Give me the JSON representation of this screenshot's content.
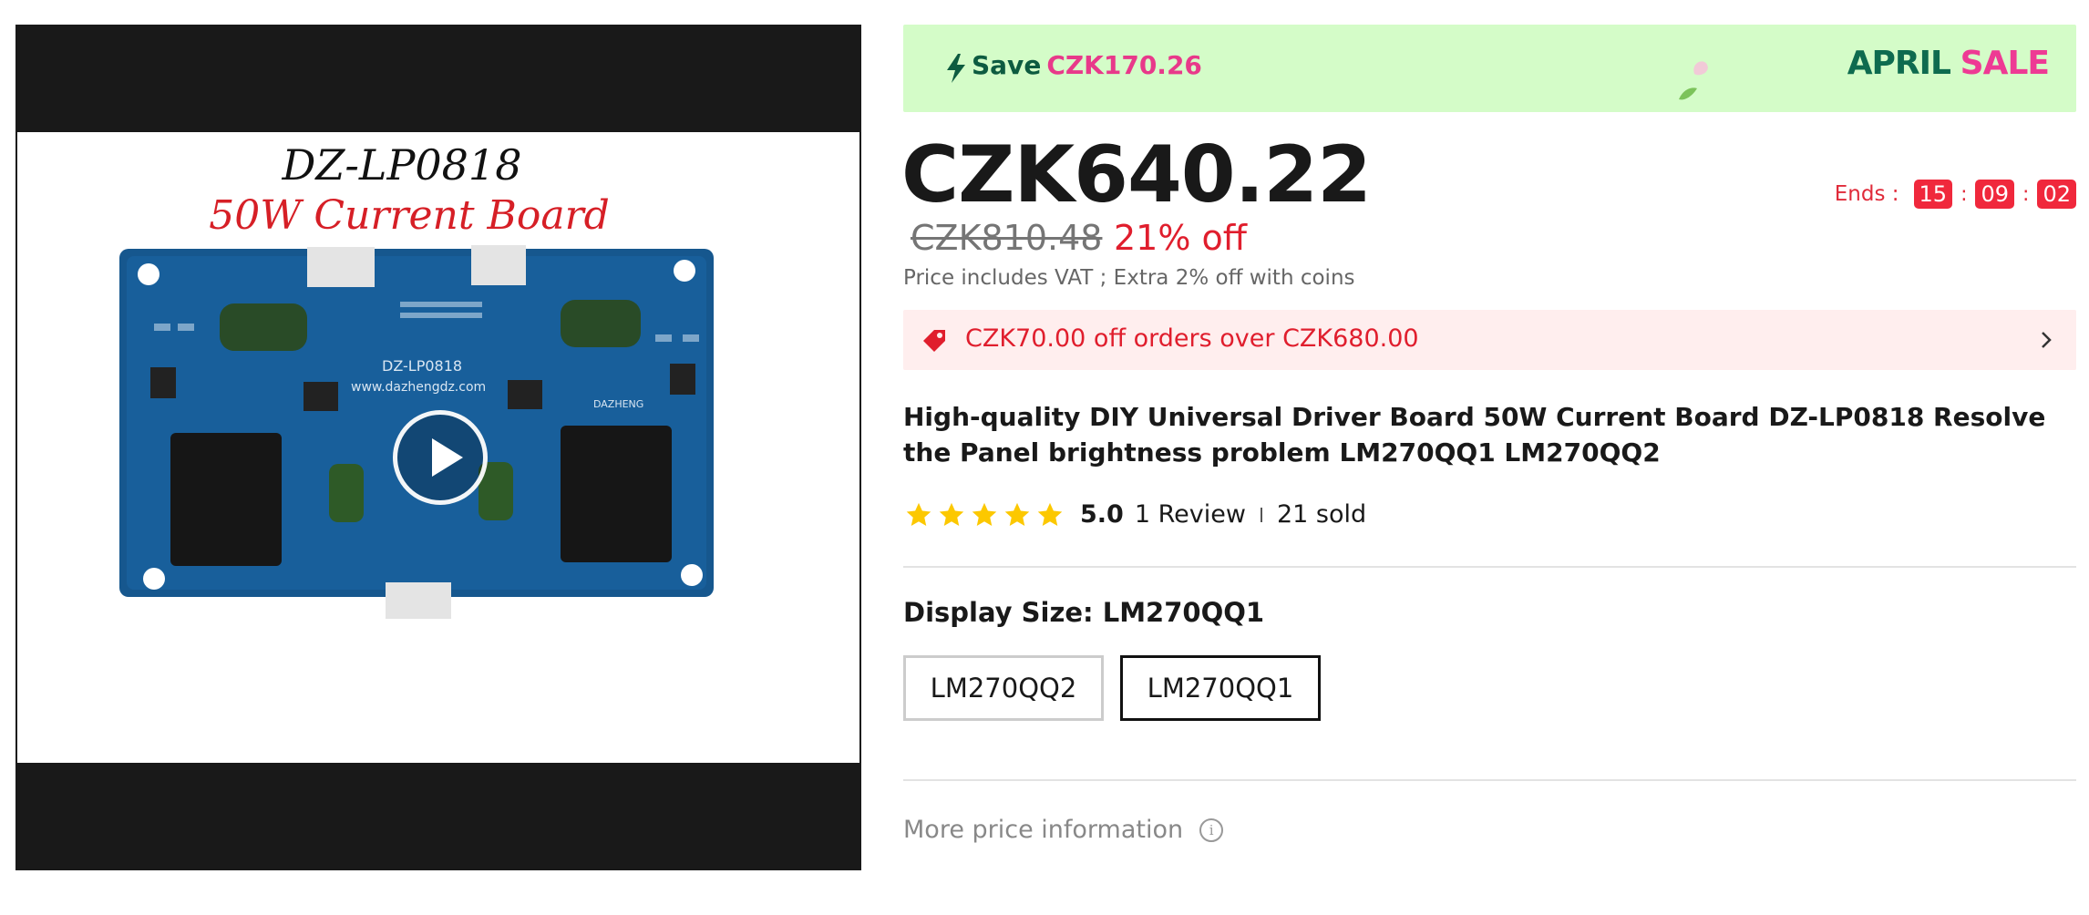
{
  "media": {
    "image_caption_line1": "DZ-LP0818",
    "image_caption_line2": "50W Current Board",
    "board_silkscreen": "DZ-LP0818",
    "board_url": "www.dazhengdz.com",
    "board_brand": "DAZHENG"
  },
  "banner": {
    "save_label": "Save",
    "save_amount": "CZK170.26",
    "sale_word_1": "APRIL",
    "sale_word_2": "SALE",
    "bg_color": "#d4fcc8"
  },
  "price": {
    "current": "CZK640.22",
    "original": "CZK810.48",
    "discount": "21% off",
    "vat_note": "Price includes VAT ; Extra 2% off with coins"
  },
  "countdown": {
    "label": "Ends :",
    "hours": "15",
    "minutes": "09",
    "seconds": "02"
  },
  "coupon": {
    "text": "CZK70.00 off orders over CZK680.00",
    "icon": "tag-icon"
  },
  "product": {
    "title": "High-quality DIY Universal Driver Board 50W Current Board DZ-LP0818 Resolve the Panel brightness problem LM270QQ1 LM270QQ2",
    "rating_value": 5,
    "rating_text": "5.0",
    "reviews": "1 Review",
    "sold": "21 sold"
  },
  "variant": {
    "label": "Display Size: LM270QQ1",
    "options": [
      {
        "label": "LM270QQ2",
        "selected": false
      },
      {
        "label": "LM270QQ1",
        "selected": true
      }
    ]
  },
  "more_info": {
    "label": "More price information",
    "icon": "info-icon"
  },
  "colors": {
    "accent_red": "#e01e2d",
    "timer_red": "#f0283c",
    "star_yellow": "#fcc800",
    "sale_green": "#0e6b4f",
    "sale_pink": "#ee3a94"
  }
}
